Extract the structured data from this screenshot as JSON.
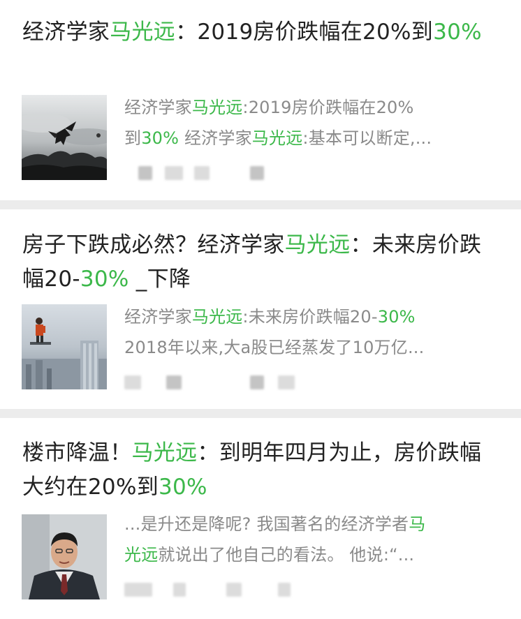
{
  "results": [
    {
      "title_parts": [
        {
          "text": "经济学家",
          "hl": false
        },
        {
          "text": "马光远",
          "hl": true
        },
        {
          "text": "：2019房价跌幅在20%到",
          "hl": false
        },
        {
          "text": "30%",
          "hl": true
        }
      ],
      "snippet_lines": [
        [
          {
            "text": "经济学家",
            "hl": false
          },
          {
            "text": "马光远",
            "hl": true
          },
          {
            "text": ":2019房价跌幅在20%",
            "hl": false
          }
        ],
        [
          {
            "text": "到",
            "hl": false
          },
          {
            "text": "30%",
            "hl": true
          },
          {
            "text": " 经济学家",
            "hl": false
          },
          {
            "text": "马光远",
            "hl": true
          },
          {
            "text": ":基本可以断定,...",
            "hl": false
          }
        ]
      ],
      "thumbnail": "bird-over-clouds-photo"
    },
    {
      "title_parts": [
        {
          "text": "房子下跌成必然？经济学家",
          "hl": false
        },
        {
          "text": "马光远",
          "hl": true
        },
        {
          "text": "：未来房价跌幅20-",
          "hl": false
        },
        {
          "text": "30%",
          "hl": true
        },
        {
          "text": " _下降",
          "hl": false
        }
      ],
      "snippet_lines": [
        [
          {
            "text": "经济学家",
            "hl": false
          },
          {
            "text": "马光远",
            "hl": true
          },
          {
            "text": ":未来房价跌幅20-",
            "hl": false
          },
          {
            "text": "30%",
            "hl": true
          }
        ],
        [
          {
            "text": "2018年以来,大a股已经蒸发了10万亿...",
            "hl": false
          }
        ]
      ],
      "thumbnail": "man-on-skyscraper-photo"
    },
    {
      "title_parts": [
        {
          "text": "楼市降温！",
          "hl": false
        },
        {
          "text": "马光远",
          "hl": true
        },
        {
          "text": "：到明年四月为止，房价跌幅大约在20%到",
          "hl": false
        },
        {
          "text": "30%",
          "hl": true
        }
      ],
      "snippet_lines": [
        [
          {
            "text": "...是升还是降呢? 我国著名的经济学者",
            "hl": false
          },
          {
            "text": "马",
            "hl": true
          }
        ],
        [
          {
            "text": "光远",
            "hl": true
          },
          {
            "text": "就说出了他自己的看法。 他说:“...",
            "hl": false
          }
        ]
      ],
      "thumbnail": "portrait-photo"
    }
  ],
  "colors": {
    "highlight": "#3cb84a",
    "snippet": "#8a8a8a",
    "title": "#222222",
    "separator": "#ececec"
  }
}
